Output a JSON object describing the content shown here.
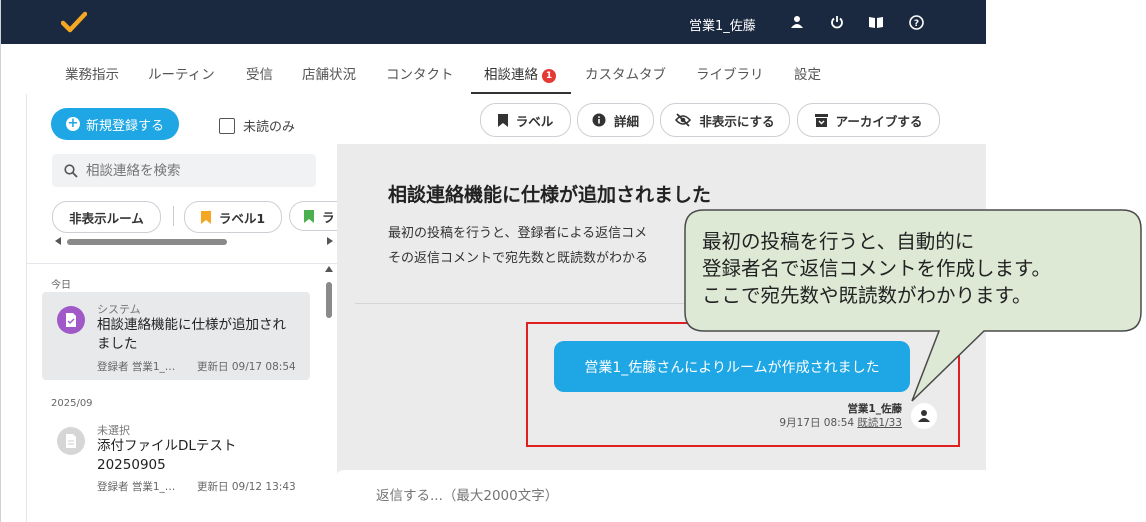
{
  "header": {
    "user_name": "営業1_佐藤"
  },
  "nav": {
    "tabs": [
      {
        "label": "業務指示"
      },
      {
        "label": "ルーティン"
      },
      {
        "label": "受信"
      },
      {
        "label": "店舗状況"
      },
      {
        "label": "コンタクト"
      },
      {
        "label": "相談連絡",
        "badge": "1"
      },
      {
        "label": "カスタムタブ"
      },
      {
        "label": "ライブラリ"
      },
      {
        "label": "設定"
      }
    ]
  },
  "sidebar": {
    "new_button": "新規登録する",
    "unread_only": "未読のみ",
    "search_placeholder": "相談連絡を検索",
    "chips": [
      "非表示ルーム",
      "ラベル1",
      "ラ"
    ],
    "groups": [
      "今日",
      "2025/09"
    ],
    "items": [
      {
        "sender": "システム",
        "title": "相談連絡機能に仕様が追加されました",
        "registrant": "登録者 営業1_…",
        "updated": "更新日 09/17 08:54"
      },
      {
        "sender": "未選択",
        "title": "添付ファイルDLテスト20250905",
        "registrant": "登録者 営業1_…",
        "updated": "更新日 09/12 13:43"
      }
    ]
  },
  "toolbar": {
    "label": "ラベル",
    "detail": "詳細",
    "hide": "非表示にする",
    "archive": "アーカイブする"
  },
  "post": {
    "title": "相談連絡機能に仕様が追加されました",
    "line1": "最初の投稿を行うと、登録者による返信コメ",
    "line2": "その返信コメントで宛先数と既読数がわかる"
  },
  "message": {
    "text": "営業1_佐藤さんによりルームが作成されました",
    "author": "営業1_佐藤",
    "datetime": "9月17日 08:54",
    "read": "既読1/33"
  },
  "reply": {
    "placeholder": "返信する...（最大2000文字）"
  },
  "callout": {
    "line1": "最初の投稿を行うと、自動的に",
    "line2": "登録者名で返信コメントを作成します。",
    "line3": "ここで宛先数や既読数がわかります。"
  },
  "colors": {
    "header_bg": "#1b2940",
    "accent": "#1ea7e4",
    "badge": "#e53935",
    "highlight_border": "#e02020",
    "callout_bg": "#dde9d5",
    "callout_border": "#4a4a4a"
  }
}
